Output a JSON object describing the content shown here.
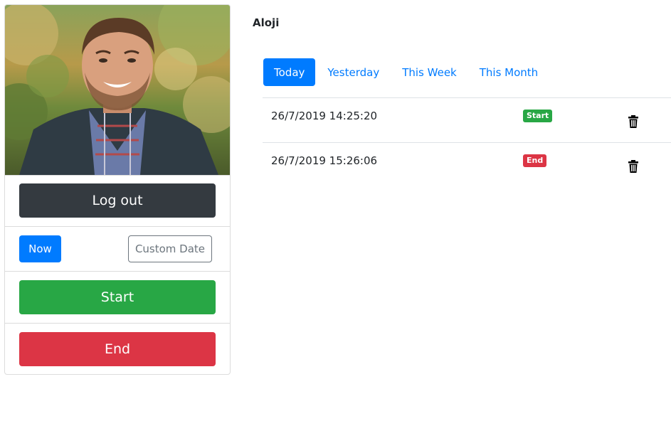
{
  "user": {
    "name": "Aloji"
  },
  "actions": {
    "logout_label": "Log out",
    "now_label": "Now",
    "custom_date_label": "Custom Date",
    "start_label": "Start",
    "end_label": "End"
  },
  "tabs": [
    {
      "label": "Today",
      "active": true
    },
    {
      "label": "Yesterday",
      "active": false
    },
    {
      "label": "This Week",
      "active": false
    },
    {
      "label": "This Month",
      "active": false
    }
  ],
  "entries": [
    {
      "datetime": "26/7/2019 14:25:20",
      "badge": "Start",
      "badge_color": "#28a745"
    },
    {
      "datetime": "26/7/2019 15:26:06",
      "badge": "End",
      "badge_color": "#dc3545"
    }
  ],
  "icons": {
    "delete": "trash-icon",
    "avatar": "profile-photo"
  },
  "colors": {
    "primary": "#007bff",
    "success": "#28a745",
    "danger": "#dc3545",
    "dark": "#343a40",
    "secondary": "#6c757d"
  }
}
